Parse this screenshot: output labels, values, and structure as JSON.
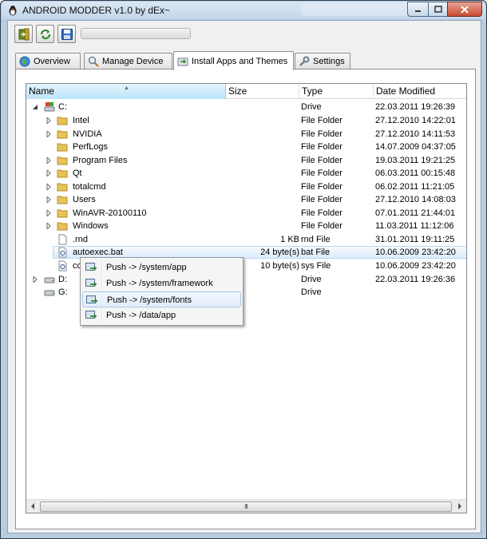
{
  "window": {
    "title": "ANDROID MODDER v1.0 by dEx~"
  },
  "tabs": [
    {
      "label": "Overview",
      "icon": "globe-icon"
    },
    {
      "label": "Manage Device",
      "icon": "magnifier-icon"
    },
    {
      "label": "Install Apps and Themes",
      "icon": "install-icon",
      "active": true
    },
    {
      "label": "Settings",
      "icon": "wrench-icon"
    }
  ],
  "columns": {
    "name": "Name",
    "size": "Size",
    "type": "Type",
    "date": "Date Modified"
  },
  "rows": [
    {
      "name": "C:",
      "size": "",
      "type": "Drive",
      "date": "22.03.2011 19:26:39"
    },
    {
      "name": "Intel",
      "size": "",
      "type": "File Folder",
      "date": "27.12.2010 14:22:01"
    },
    {
      "name": "NVIDIA",
      "size": "",
      "type": "File Folder",
      "date": "27.12.2010 14:11:53"
    },
    {
      "name": "PerfLogs",
      "size": "",
      "type": "File Folder",
      "date": "14.07.2009 04:37:05"
    },
    {
      "name": "Program Files",
      "size": "",
      "type": "File Folder",
      "date": "19.03.2011 19:21:25"
    },
    {
      "name": "Qt",
      "size": "",
      "type": "File Folder",
      "date": "06.03.2011 00:15:48"
    },
    {
      "name": "totalcmd",
      "size": "",
      "type": "File Folder",
      "date": "06.02.2011 11:21:05"
    },
    {
      "name": "Users",
      "size": "",
      "type": "File Folder",
      "date": "27.12.2010 14:08:03"
    },
    {
      "name": "WinAVR-20100110",
      "size": "",
      "type": "File Folder",
      "date": "07.01.2011 21:44:01"
    },
    {
      "name": "Windows",
      "size": "",
      "type": "File Folder",
      "date": "11.03.2011 11:12:06"
    },
    {
      "name": ".rnd",
      "size": "1 KB",
      "type": "rnd File",
      "date": "31.01.2011 19:11:25"
    },
    {
      "name": "autoexec.bat",
      "size": "24 byte(s)",
      "type": "bat File",
      "date": "10.06.2009 23:42:20"
    },
    {
      "name": "co",
      "size": "10 byte(s)",
      "type": "sys File",
      "date": "10.06.2009 23:42:20"
    },
    {
      "name": "D:",
      "size": "",
      "type": "Drive",
      "date": "22.03.2011 19:26:36"
    },
    {
      "name": "G:",
      "size": "",
      "type": "Drive",
      "date": ""
    }
  ],
  "context_menu": [
    {
      "label": "Push -> /system/app"
    },
    {
      "label": "Push -> /system/framework"
    },
    {
      "label": "Push -> /system/fonts",
      "highlighted": true
    },
    {
      "label": "Push -> /data/app"
    }
  ],
  "scrollbar": {
    "thumb_grip": "III"
  }
}
